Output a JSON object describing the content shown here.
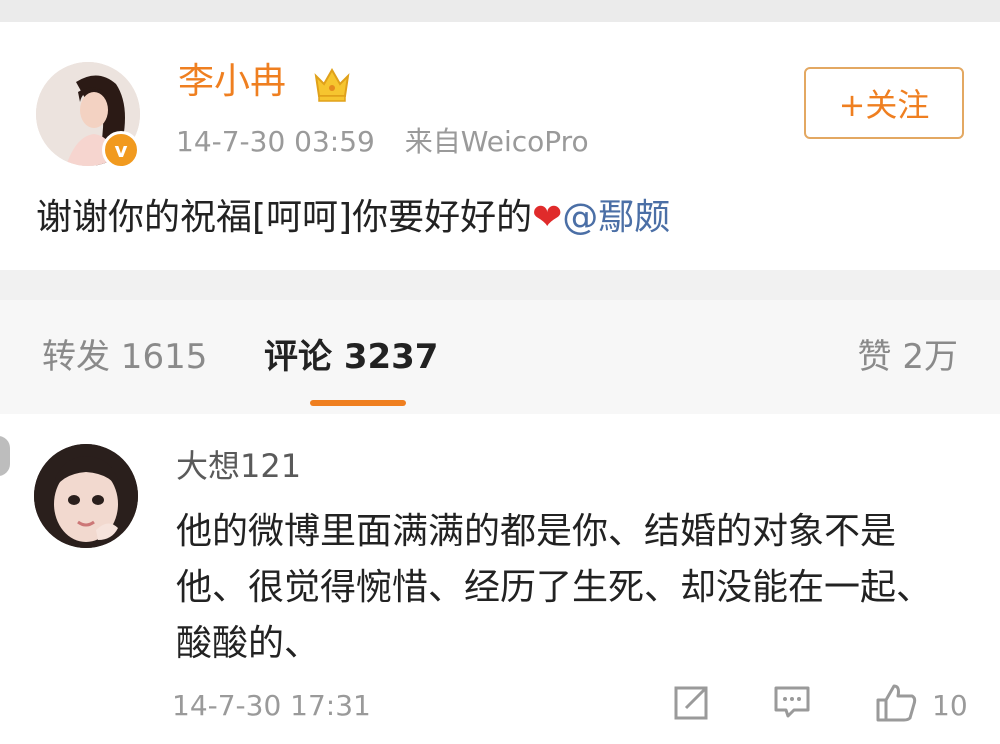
{
  "post": {
    "username": "李小冉",
    "vip_icon": "crown-icon",
    "verified_badge": "v",
    "timestamp": "14-7-30 03:59",
    "source": "来自WeicoPro",
    "follow_label": "+关注",
    "text": "谢谢你的祝福[呵呵]你要好好的",
    "heart": "❤",
    "mention": "@鄢颇"
  },
  "tabs": {
    "repost": "转发 1615",
    "comment": "评论 3237",
    "like": "赞 2万"
  },
  "comment": {
    "username": "大想121",
    "text": "他的微博里面满满的都是你、结婚的对象不是他、很觉得惋惜、经历了生死、却没能在一起、酸酸的、",
    "timestamp": "14-7-30 17:31",
    "like_count": "10",
    "icons": [
      "share-icon",
      "reply-icon",
      "thumbs-up-icon"
    ]
  },
  "colors": {
    "accent": "#ef7f20",
    "mention": "#4b6fa6",
    "heart": "#e02b2b"
  }
}
